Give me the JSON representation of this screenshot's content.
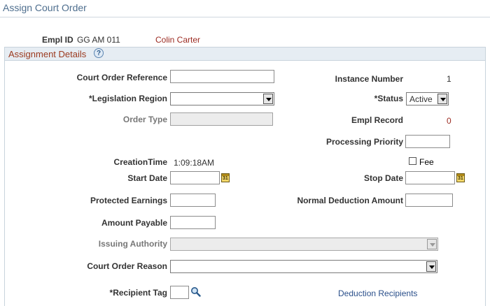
{
  "page": {
    "title": "Assign Court Order"
  },
  "employee": {
    "empl_id_label": "Empl ID",
    "empl_id": "GG AM 011",
    "name": "Colin Carter"
  },
  "section": {
    "title": "Assignment Details",
    "help_glyph": "?"
  },
  "form": {
    "court_order_reference_label": "Court Order Reference",
    "court_order_reference_value": "",
    "instance_number_label": "Instance Number",
    "instance_number": "1",
    "legislation_region_label": "*Legislation Region",
    "legislation_region_value": "",
    "status_label": "*Status",
    "status_value": "Active",
    "order_type_label": "Order Type",
    "empl_record_label": "Empl Record",
    "empl_record": "0",
    "processing_priority_label": "Processing Priority",
    "creation_time_label": "CreationTime",
    "creation_time": "1:09:18AM",
    "fee_label": "Fee",
    "start_date_label": "Start Date",
    "stop_date_label": "Stop Date",
    "protected_earnings_label": "Protected Earnings",
    "normal_deduction_amount_label": "Normal Deduction Amount",
    "amount_payable_label": "Amount Payable",
    "issuing_authority_label": "Issuing Authority",
    "court_order_reason_label": "Court Order Reason",
    "recipient_tag_label": "*Recipient Tag",
    "deduction_recipients_link": "Deduction Recipients",
    "calendar_glyph": "31"
  },
  "colors": {
    "title": "#4e6e8e",
    "section_title": "#9b3a1f",
    "name": "#9b2a21",
    "link": "#2a4f8a",
    "section_bar": "#e6edf3"
  },
  "icons": [
    "help-icon",
    "calendar-icon",
    "search-icon",
    "dropdown-arrow-icon"
  ]
}
